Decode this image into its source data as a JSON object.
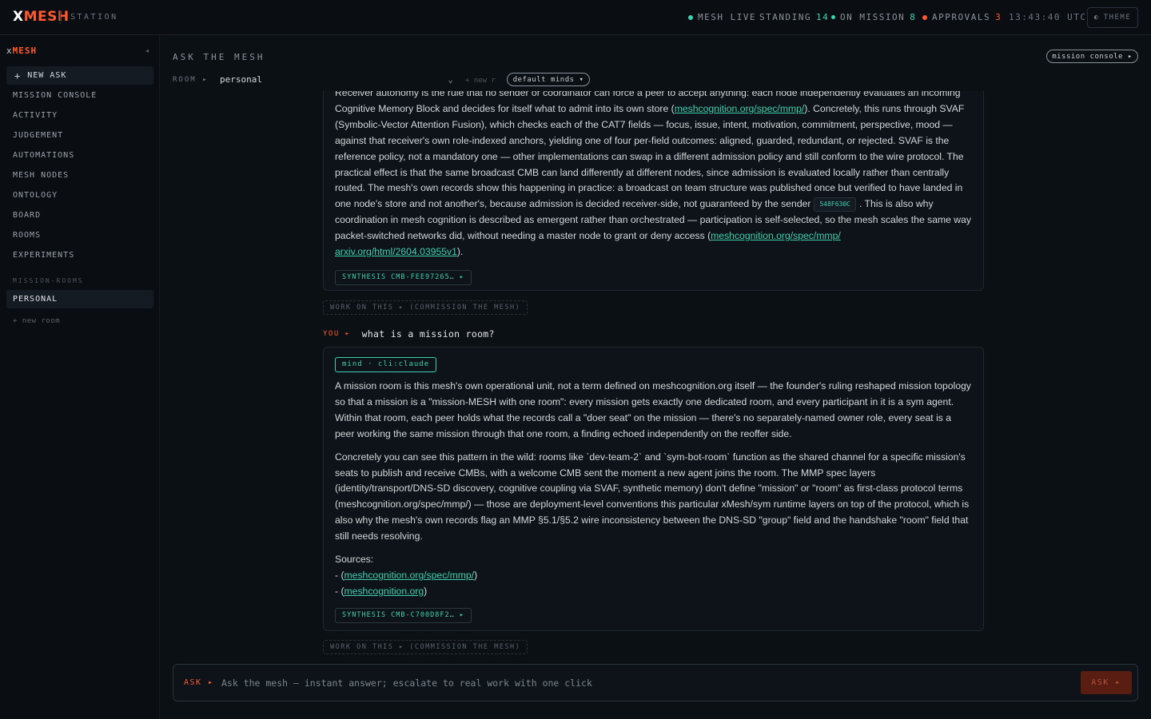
{
  "topbar": {
    "brand_x": "X",
    "brand_mesh": "MESH",
    "station": "STATION",
    "mesh_live": "MESH LIVE",
    "standing_label": "STANDING",
    "standing_count": "14",
    "on_mission_label": "ON MISSION",
    "on_mission_count": "8",
    "approvals_label": "APPROVALS",
    "approvals_count": "3",
    "clock": "13:43:40 UTC",
    "theme_label": "THEME",
    "theme_icon": "◐"
  },
  "sidebar": {
    "brand_x": "x",
    "brand_mesh": "MESH",
    "collapse_icon": "◂",
    "new_ask": "NEW ASK",
    "nav": [
      "MISSION CONSOLE",
      "ACTIVITY",
      "JUDGEMENT",
      "AUTOMATIONS",
      "MESH NODES",
      "ONTOLOGY",
      "BOARD",
      "ROOMS",
      "EXPERIMENTS"
    ],
    "section_label": "MISSION-ROOMS",
    "active_room": "PERSONAL",
    "new_room": "+ new room"
  },
  "header": {
    "title": "ASK THE MESH",
    "console_button": "mission console ▸",
    "room_label": "ROOM ▸",
    "room_value": "personal",
    "new_room_short": "+ new r",
    "minds_button": "default minds ▾"
  },
  "messages": [
    {
      "first_line": "Receiver autonomy is the rule that no sender or coordinator can force a peer to accept anything: each node independently evaluates an incoming",
      "p1_a": "Cognitive Memory Block and decides for itself what to admit into its own store (",
      "link1": "meshcognition.org/spec/mmp/",
      "p1_b": "). Concretely, this runs through SVAF (Symbolic-Vector Attention Fusion), which checks each of the CAT7 fields — focus, issue, intent, motivation, commitment, perspective, mood — against that receiver's own role-indexed anchors, yielding one of four per-field outcomes: aligned, guarded, redundant, or rejected. SVAF is the reference policy, not a mandatory one — other implementations can swap in a different admission policy and still conform to the wire protocol. The practical effect is that the same broadcast CMB can land differently at different nodes, since admission is evaluated locally rather than centrally routed. The mesh's own records show this happening in practice: a broadcast on team structure was published once but verified to have landed in one node's store and not another's, because admission is decided receiver-side, not guaranteed by the sender",
      "code": "548F630C",
      "p1_c": ". This is also why coordination in mesh cognition is described as emergent rather than orchestrated — participation is self-selected, so the mesh scales the same way packet-switched networks did, without needing a master node to grant or deny access (",
      "link2": "meshcognition.org/spec/mmp/",
      "link3": "arxiv.org/html/2604.03955v1",
      "p1_d": ").",
      "synthesis": "SYNTHESIS CMB-FEE97265… ▸",
      "work": "WORK ON THIS ▸ (COMMISSION THE MESH)"
    },
    {
      "you_tag": "YOU ▸",
      "question": "what is a mission room?",
      "mind": "mind · cli:claude",
      "p1": "A mission room is this mesh's own operational unit, not a term defined on meshcognition.org itself — the founder's ruling reshaped mission topology so that a mission is a \"mission-MESH with one room\": every mission gets exactly one dedicated room, and every participant in it is a sym agent. Within that room, each peer holds what the records call a \"doer seat\" on the mission — there's no separately-named owner role, every seat is a peer working the same mission through that one room, a finding echoed independently on the reoffer side.",
      "p2": "Concretely you can see this pattern in the wild: rooms like `dev-team-2` and `sym-bot-room` function as the shared channel for a specific mission's seats to publish and receive CMBs, with a welcome CMB sent the moment a new agent joins the room. The MMP spec layers (identity/transport/DNS-SD discovery, cognitive coupling via SVAF, synthetic memory) don't define \"mission\" or \"room\" as first-class protocol terms (meshcognition.org/spec/mmp/) — those are deployment-level conventions this particular xMesh/sym runtime layers on top of the protocol, which is also why the mesh's own records flag an MMP §5.1/§5.2 wire inconsistency between the DNS-SD \"group\" field and the handshake \"room\" field that still needs resolving.",
      "sources_label": "Sources:",
      "source1_prefix": "- (",
      "source1": "meshcognition.org/spec/mmp/",
      "source2": "meshcognition.org",
      "source_suffix": ")",
      "synthesis": "SYNTHESIS CMB-C700D8F2… ▸",
      "work": "WORK ON THIS ▸ (COMMISSION THE MESH)"
    }
  ],
  "composer": {
    "ask_tag": "ASK ▸",
    "placeholder": "Ask the mesh — instant answer; escalate to real work with one click",
    "button": "ASK ▸"
  }
}
